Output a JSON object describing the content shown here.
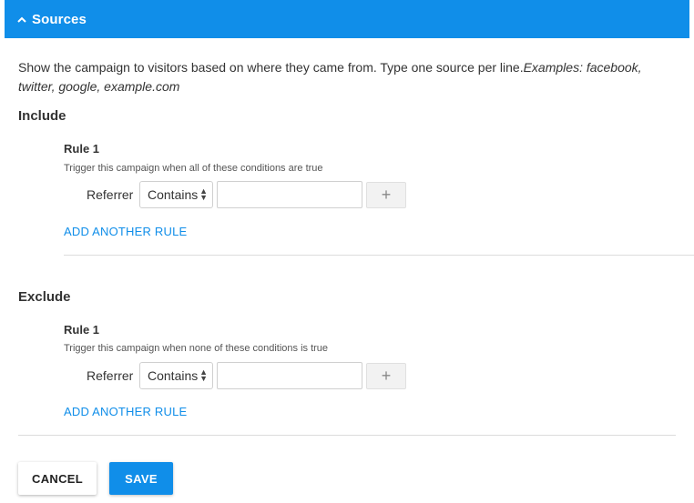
{
  "header": {
    "title": "Sources",
    "icon": "chevron-up-icon",
    "color": "#108ee9"
  },
  "description": {
    "text": "Show the campaign to visitors based on where they came from. Type one source per line.",
    "examples": "Examples: facebook, twitter, google, example.com"
  },
  "include": {
    "title": "Include",
    "rule_title": "Rule 1",
    "rule_subtitle": "Trigger this campaign when all of these conditions are true",
    "condition": {
      "label": "Referrer",
      "operator": "Contains",
      "value": ""
    },
    "plus_label": "+",
    "add_rule_label": "ADD ANOTHER RULE"
  },
  "exclude": {
    "title": "Exclude",
    "rule_title": "Rule 1",
    "rule_subtitle": "Trigger this campaign when none of these conditions is true",
    "condition": {
      "label": "Referrer",
      "operator": "Contains",
      "value": ""
    },
    "plus_label": "+",
    "add_rule_label": "ADD ANOTHER RULE"
  },
  "footer": {
    "cancel_label": "CANCEL",
    "save_label": "SAVE"
  }
}
